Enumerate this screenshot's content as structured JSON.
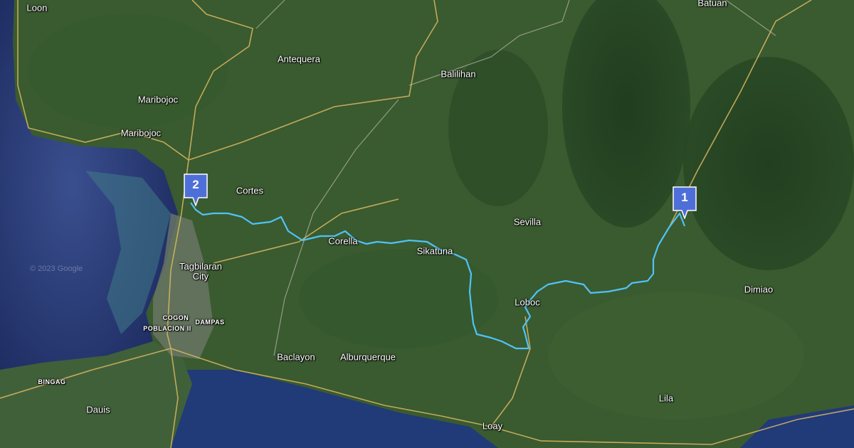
{
  "map": {
    "watermark": "© 2023 Google",
    "route_color": "#4fc3f7",
    "places": {
      "loon": "Loon",
      "batuan": "Batuan",
      "antequera": "Antequera",
      "balilihan": "Balilihan",
      "maribojoc_town": "Maribojoc",
      "maribojoc": "Maribojoc",
      "cortes": "Cortes",
      "sevilla": "Sevilla",
      "corella": "Corella",
      "sikatuna": "Sikatuna",
      "tagbilaran": "Tagbilaran\nCity",
      "cogon": "COGON",
      "dampas": "DAMPAS",
      "poblacion": "POBLACION II",
      "loboc": "Loboc",
      "dimiao": "Dimiao",
      "baclayon": "Baclayon",
      "alburquerque": "Alburquerque",
      "bingag": "BINGAG",
      "dauis": "Dauis",
      "lila": "Lila",
      "loay": "Loay"
    },
    "markers": [
      {
        "label": "1"
      },
      {
        "label": "2"
      }
    ]
  }
}
